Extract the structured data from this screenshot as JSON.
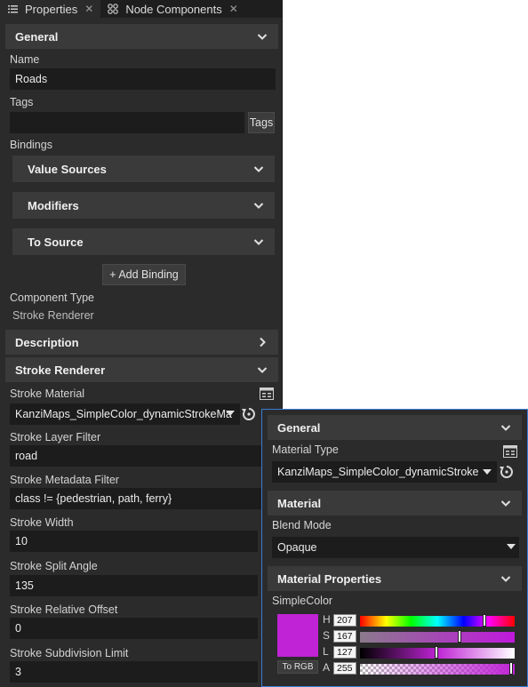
{
  "tabs": [
    {
      "label": "Properties",
      "icon": "list-icon"
    },
    {
      "label": "Node Components",
      "icon": "components-icon"
    }
  ],
  "sections": {
    "general": "General",
    "description": "Description",
    "stroke_renderer": "Stroke Renderer"
  },
  "fields": {
    "name_label": "Name",
    "name_value": "Roads",
    "tags_label": "Tags",
    "tags_value": "",
    "tags_button": "Tags",
    "bindings_label": "Bindings",
    "component_type_label": "Component Type",
    "component_type_value": "Stroke Renderer"
  },
  "bindings": {
    "value_sources": "Value Sources",
    "modifiers": "Modifiers",
    "to_source": "To Source",
    "add_binding": "+ Add Binding"
  },
  "stroke": {
    "material_label": "Stroke Material",
    "material_value": "KanziMaps_SimpleColor_dynamicStrokeMa",
    "layer_filter_label": "Stroke Layer Filter",
    "layer_filter_value": "road",
    "metadata_filter_label": "Stroke Metadata Filter",
    "metadata_filter_value": "class != {pedestrian, path, ferry}",
    "width_label": "Stroke Width",
    "width_value": "10",
    "split_angle_label": "Stroke Split Angle",
    "split_angle_value": "135",
    "relative_offset_label": "Stroke Relative  Offset",
    "relative_offset_value": "0",
    "subdivision_label": "Stroke Subdivision Limit",
    "subdivision_value": "3"
  },
  "popup": {
    "general": "General",
    "material_type_label": "Material Type",
    "material_type_value": "KanziMaps_SimpleColor_dynamicStroke",
    "material_section": "Material",
    "blend_mode_label": "Blend Mode",
    "blend_mode_value": "Opaque",
    "material_properties": "Material Properties",
    "simple_color_label": "SimpleColor",
    "color_hex": "#bf23d5",
    "h_label": "H",
    "h_value": "207",
    "s_label": "S",
    "s_value": "167",
    "l_label": "L",
    "l_value": "127",
    "a_label": "A",
    "a_value": "255",
    "to_rgb": "To RGB"
  }
}
